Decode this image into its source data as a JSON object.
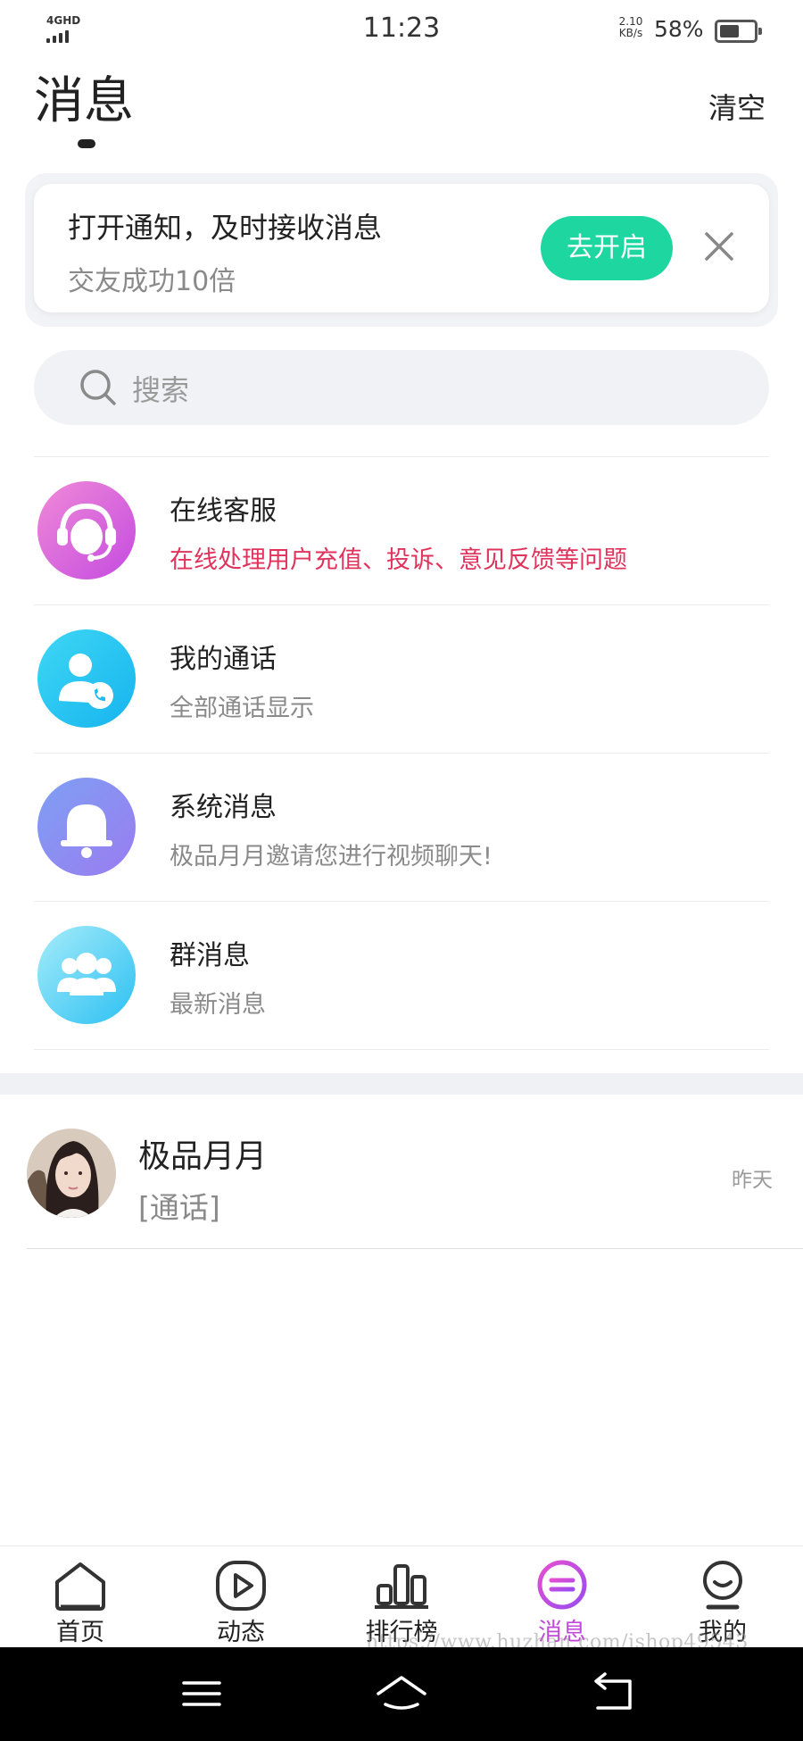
{
  "status_bar": {
    "network": "4GHD",
    "time": "11:23",
    "speed_value": "2.10",
    "speed_unit": "KB/s",
    "battery_pct": "58%",
    "battery_level": 0.58
  },
  "header": {
    "title": "消息",
    "clear_label": "清空"
  },
  "notification_banner": {
    "title": "打开通知，及时接收消息",
    "subtitle": "交友成功10倍",
    "enable_label": "去开启",
    "close_icon": "close-icon",
    "button_color": "#1ed6a0"
  },
  "search": {
    "placeholder": "搜索",
    "icon": "search-icon"
  },
  "list": {
    "items": [
      {
        "title": "在线客服",
        "subtitle": "在线处理用户充值、投诉、意见反馈等问题",
        "icon": "headset-icon"
      },
      {
        "title": "我的通话",
        "subtitle": "全部通话显示",
        "icon": "user-phone-icon"
      },
      {
        "title": "系统消息",
        "subtitle": "极品月月邀请您进行视频聊天!",
        "icon": "bell-icon"
      },
      {
        "title": "群消息",
        "subtitle": "最新消息",
        "icon": "group-icon"
      }
    ],
    "alert_color": "#e0335c"
  },
  "conversations": [
    {
      "name": "极品月月",
      "message": "[通话]",
      "time": "昨天"
    }
  ],
  "tab_bar": {
    "tabs": [
      {
        "label": "首页",
        "icon": "home-icon"
      },
      {
        "label": "动态",
        "icon": "play-icon"
      },
      {
        "label": "排行榜",
        "icon": "ranking-icon"
      },
      {
        "label": "消息",
        "icon": "message-icon",
        "active": true
      },
      {
        "label": "我的",
        "icon": "profile-icon"
      }
    ],
    "active_color": "#c14ad8"
  },
  "watermark": "https://www.huzhan.com/ishop49543",
  "nav_bar": {
    "buttons": [
      "menu-icon",
      "home-nav-icon",
      "back-icon"
    ]
  }
}
